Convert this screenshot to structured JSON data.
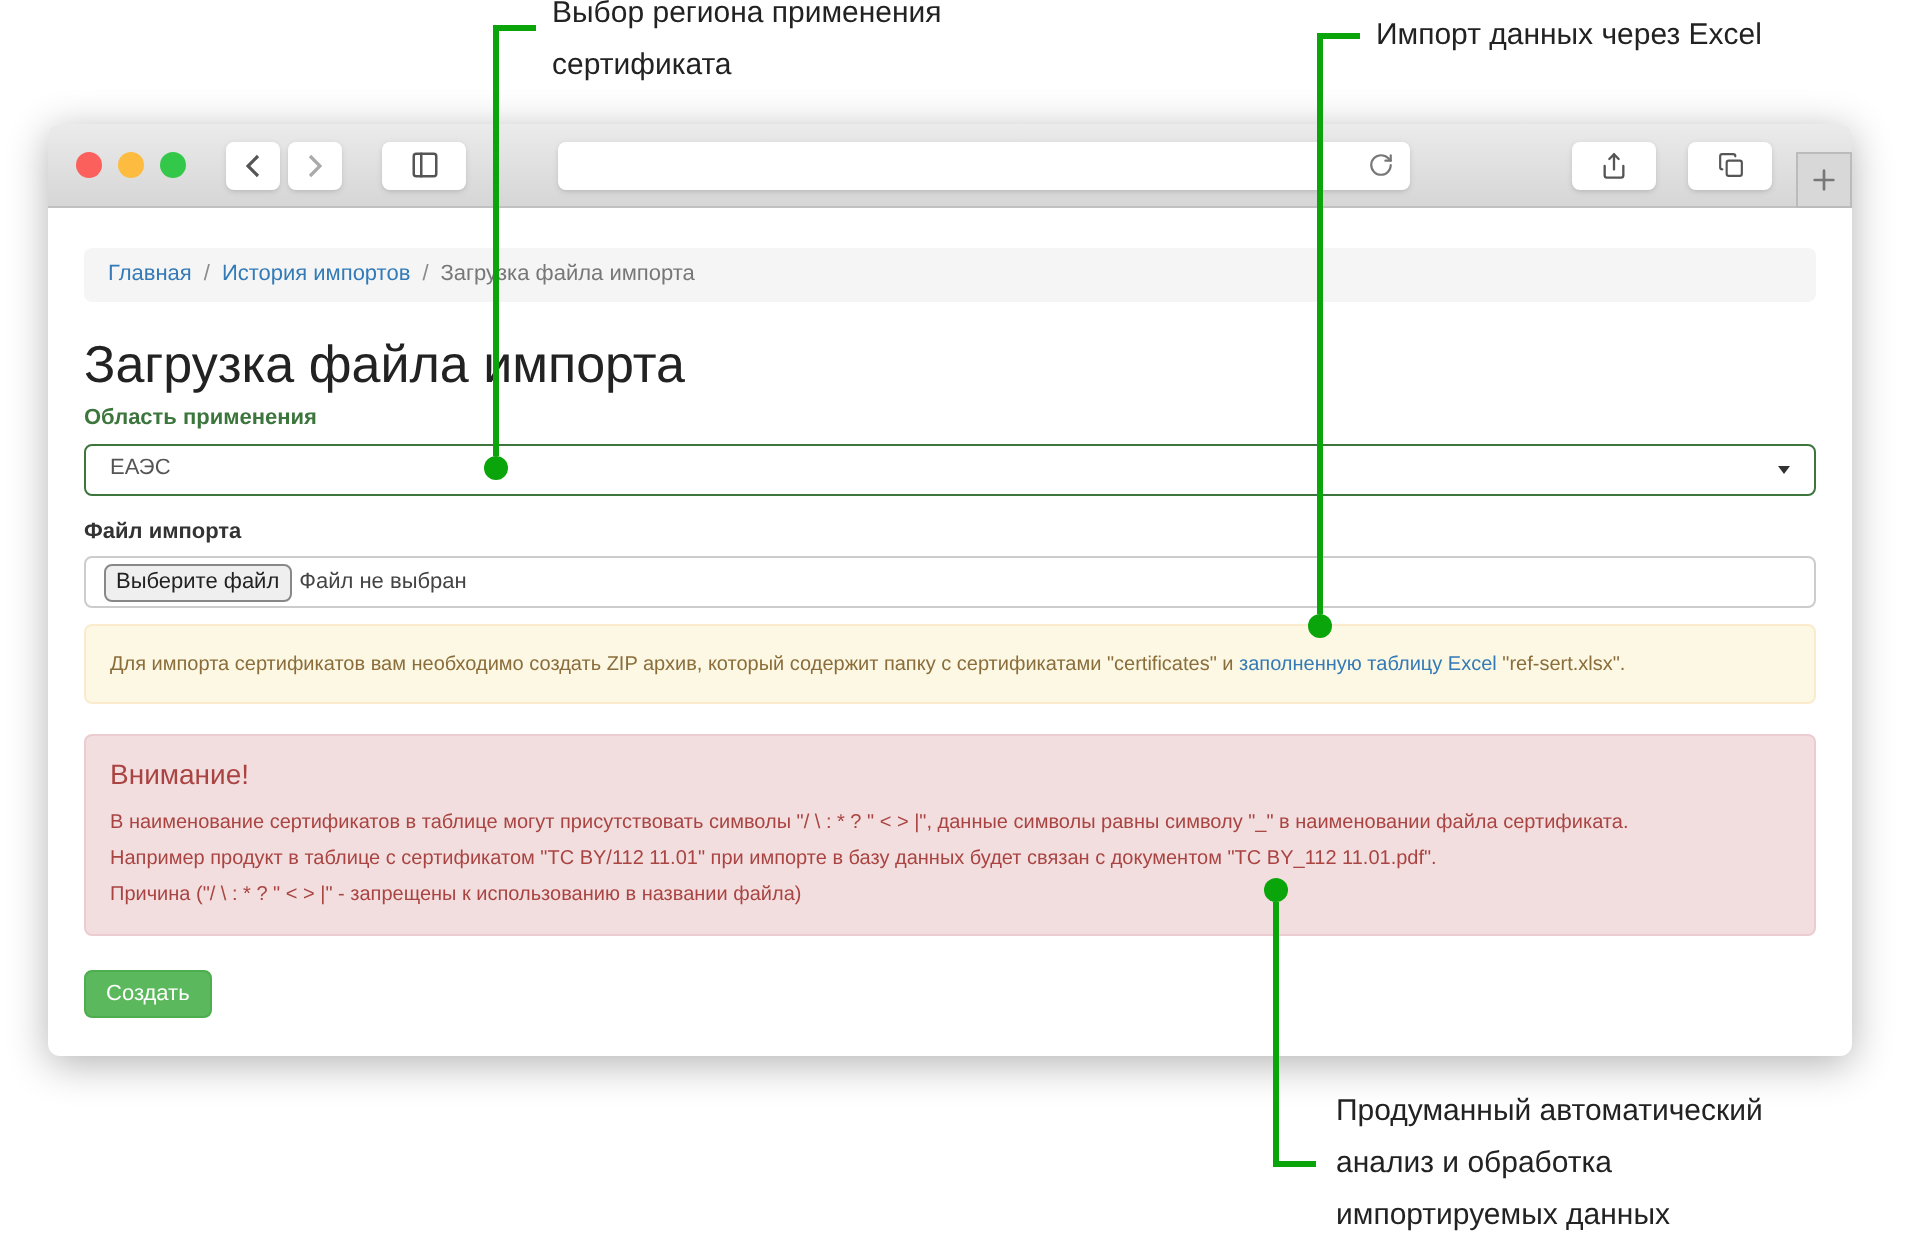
{
  "callouts": [
    {
      "lines": [
        "Выбор региона применения",
        "сертификата"
      ]
    },
    {
      "lines": [
        "Импорт данных через Excel"
      ]
    },
    {
      "lines": [
        "Продуманный автоматический",
        "анализ и обработка",
        "импортируемых данных"
      ]
    }
  ],
  "breadcrumbs": [
    {
      "label": "Главная",
      "kind": "link"
    },
    {
      "label": "История импортов",
      "kind": "link"
    },
    {
      "label": "Загрузка файла импорта",
      "kind": "current"
    }
  ],
  "breadcrumb_separator": "/",
  "title": "Загрузка файла импорта",
  "region_field": {
    "label": "Область применения",
    "value": "ЕАЭС"
  },
  "file_field": {
    "label": "Файл импорта",
    "button": "Выберите файл",
    "status": "Файл не выбран"
  },
  "info": {
    "before": "Для импорта сертификатов вам необходимо создать ZIP архив, который содержит папку с сертификатами \"certificates\" и ",
    "link": "заполненную таблицу Excel",
    "after": " \"ref-sert.xlsx\"."
  },
  "warning": {
    "heading": "Внимание!",
    "lines": [
      "В наименование сертификатов в таблице могут присутствовать символы \"/ \\ : * ? \" < > |\", данные символы равны символу \"_\" в наименовании файла сертификата.",
      "Например продукт в таблице с сертификатом \"TC BY/112 11.01\" при импорте в базу данных будет связан с документом \"TC BY_112 11.01.pdf\".",
      "Причина (\"/ \\ : * ? \" < > |\" - запрещены к использованию в названии файла)"
    ]
  },
  "submit": "Создать"
}
